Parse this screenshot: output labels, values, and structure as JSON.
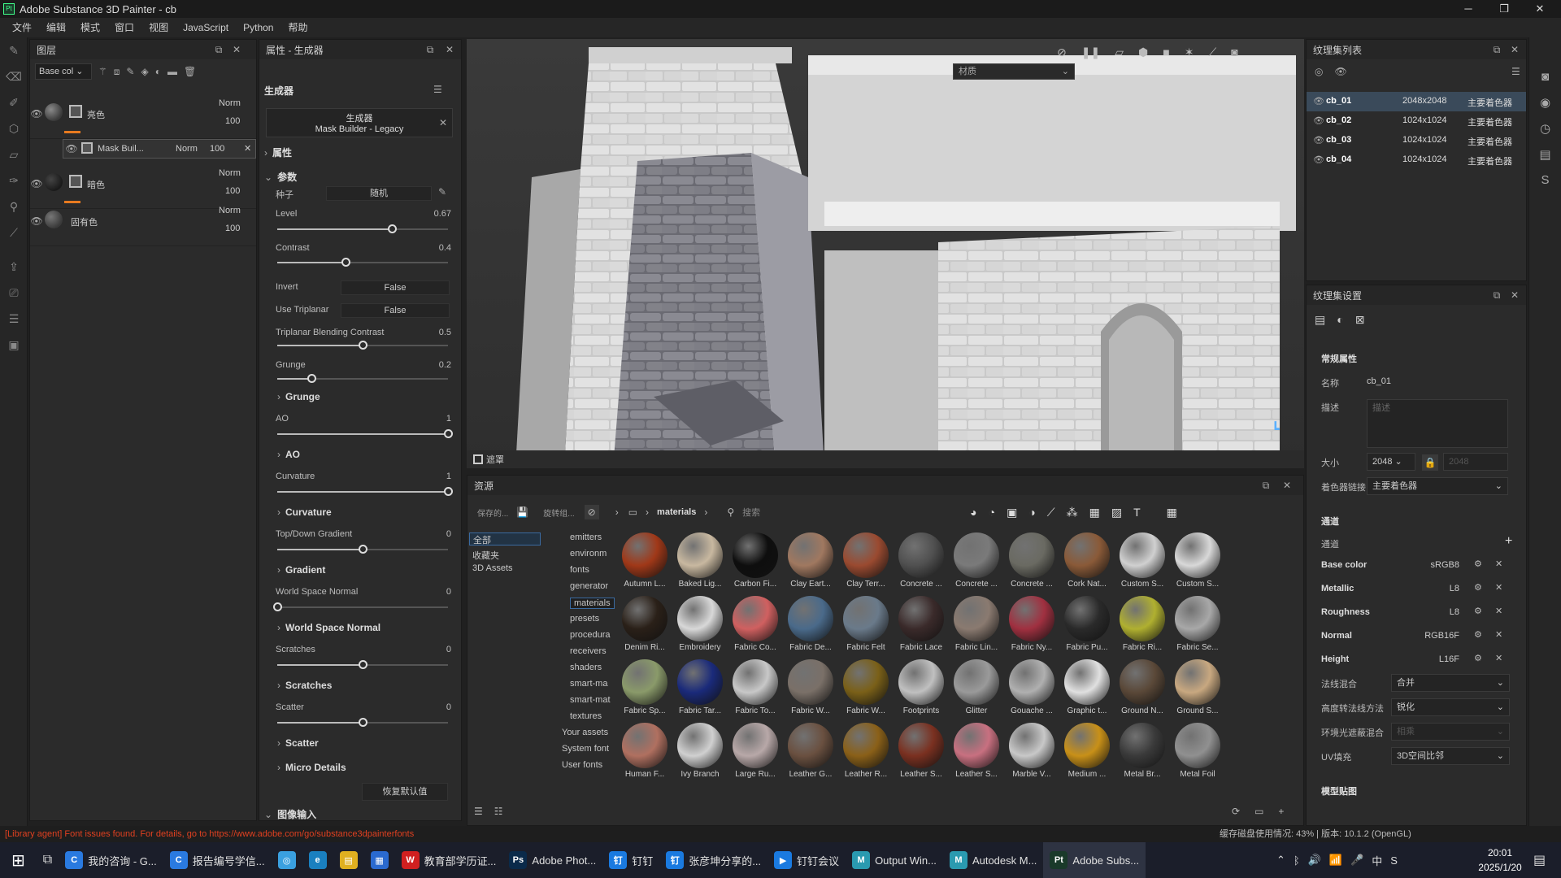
{
  "window": {
    "title": "Adobe Substance 3D Painter - cb",
    "logo": "Pt"
  },
  "menu": [
    "文件",
    "编辑",
    "模式",
    "窗口",
    "视图",
    "JavaScript",
    "Python",
    "帮助"
  ],
  "layers": {
    "title": "图层",
    "channel_select": "Base col",
    "items": [
      {
        "name": "亮色",
        "blend": "Norm",
        "opacity": "100"
      },
      {
        "name": "Mask Buil...",
        "blend": "Norm",
        "opacity": "100"
      },
      {
        "name": "暗色",
        "blend": "Norm",
        "opacity": "100"
      },
      {
        "name": "固有色",
        "blend": "Norm",
        "opacity": "100"
      }
    ]
  },
  "properties": {
    "title": "属性 - 生成器",
    "section": "生成器",
    "generator_title": "生成器",
    "generator_name": "Mask Builder - Legacy",
    "attr_label": "属性",
    "params_label": "参数",
    "seed_label": "种子",
    "seed_value": "随机",
    "params": [
      {
        "label": "Level",
        "value": "0.67",
        "pos": 0.67
      },
      {
        "label": "Contrast",
        "value": "0.4",
        "pos": 0.4
      },
      {
        "label": "Invert",
        "value": "False"
      },
      {
        "label": "Use Triplanar",
        "value": "False"
      },
      {
        "label": "Triplanar Blending Contrast",
        "value": "0.5",
        "pos": 0.5
      },
      {
        "label": "Grunge",
        "value": "0.2",
        "pos": 0.2
      },
      {
        "label": "AO",
        "value": "1",
        "pos": 1
      },
      {
        "label": "Curvature",
        "value": "1",
        "pos": 1
      },
      {
        "label": "Top/Down Gradient",
        "value": "0",
        "pos": 0.5
      },
      {
        "label": "World Space Normal",
        "value": "0",
        "pos": 0
      },
      {
        "label": "Scratches",
        "value": "0",
        "pos": 0.5
      },
      {
        "label": "Scatter",
        "value": "0",
        "pos": 0.5
      }
    ],
    "sections": [
      "Grunge",
      "AO",
      "Curvature",
      "Gradient",
      "World Space Normal",
      "Scratches",
      "Scatter",
      "Micro Details"
    ],
    "reset_button": "恢复默认值",
    "image_input": "图像输入"
  },
  "viewport": {
    "channel_select": "材质",
    "mask_label": "遮罩"
  },
  "assets": {
    "title": "资源",
    "saved_label": "保存的...",
    "filter_label": "旋转组...",
    "breadcrumb": "materials",
    "search_placeholder": "搜索",
    "left_tree": [
      "全部",
      "收藏夹",
      "3D Assets"
    ],
    "folders": [
      "emitters",
      "environm",
      "fonts",
      "generator",
      "materials",
      "presets",
      "procedura",
      "receivers",
      "shaders",
      "smart-ma",
      "smart-mat",
      "textures",
      "Your assets",
      "System font",
      "User fonts"
    ],
    "materials": [
      {
        "name": "Autumn L...",
        "color": "#a03818"
      },
      {
        "name": "Baked Lig...",
        "color": "#c8b8a0"
      },
      {
        "name": "Carbon Fi...",
        "color": "#0e0e0e"
      },
      {
        "name": "Clay Eart...",
        "color": "#a07860"
      },
      {
        "name": "Clay Terr...",
        "color": "#9a4a30"
      },
      {
        "name": "Concrete ...",
        "color": "#505050"
      },
      {
        "name": "Concrete ...",
        "color": "#7a7a7a"
      },
      {
        "name": "Concrete ...",
        "color": "#6a6a62"
      },
      {
        "name": "Cork Nat...",
        "color": "#8a5a38"
      },
      {
        "name": "Custom S...",
        "color": "#d0d0d0"
      },
      {
        "name": "Custom S...",
        "color": "#d8d8d8"
      },
      {
        "name": "Denim Ri...",
        "color": "#2a2018"
      },
      {
        "name": "Embroidery",
        "color": "#d8d8d8"
      },
      {
        "name": "Fabric Co...",
        "color": "#d06060"
      },
      {
        "name": "Fabric De...",
        "color": "#4a6a8a"
      },
      {
        "name": "Fabric Felt",
        "color": "#6a7a8a"
      },
      {
        "name": "Fabric Lace",
        "color": "#3a2a2a"
      },
      {
        "name": "Fabric Lin...",
        "color": "#8a7a70"
      },
      {
        "name": "Fabric Ny...",
        "color": "#a03040"
      },
      {
        "name": "Fabric Pu...",
        "color": "#2a2a2a"
      },
      {
        "name": "Fabric Ri...",
        "color": "#b0b030"
      },
      {
        "name": "Fabric Se...",
        "color": "#a8a8a8"
      },
      {
        "name": "Fabric Sp...",
        "color": "#8a9a6a"
      },
      {
        "name": "Fabric Tar...",
        "color": "#1a2a7a"
      },
      {
        "name": "Fabric To...",
        "color": "#c8c8c8"
      },
      {
        "name": "Fabric W...",
        "color": "#7a7068"
      },
      {
        "name": "Fabric W...",
        "color": "#7a6018"
      },
      {
        "name": "Footprints",
        "color": "#c0c0c0"
      },
      {
        "name": "Glitter",
        "color": "#9a9a9a"
      },
      {
        "name": "Gouache ...",
        "color": "#b0b0b0"
      },
      {
        "name": "Graphic t...",
        "color": "#e0e0e0"
      },
      {
        "name": "Ground N...",
        "color": "#5a4838"
      },
      {
        "name": "Ground S...",
        "color": "#c8a880"
      },
      {
        "name": "Human F...",
        "color": "#b07060"
      },
      {
        "name": "Ivy Branch",
        "color": "#d0d0d0"
      },
      {
        "name": "Large Ru...",
        "color": "#b8a8a8"
      },
      {
        "name": "Leather G...",
        "color": "#6a5040"
      },
      {
        "name": "Leather R...",
        "color": "#8a6018"
      },
      {
        "name": "Leather S...",
        "color": "#7a3020"
      },
      {
        "name": "Leather S...",
        "color": "#c87080"
      },
      {
        "name": "Marble V...",
        "color": "#c8c8c8"
      },
      {
        "name": "Medium ...",
        "color": "#c89018"
      },
      {
        "name": "Metal Br...",
        "color": "#3a3a3a"
      },
      {
        "name": "Metal Foil",
        "color": "#909090"
      }
    ]
  },
  "texture_sets": {
    "title": "纹理集列表",
    "rows": [
      {
        "name": "cb_01",
        "size": "2048x2048",
        "shader": "主要着色器"
      },
      {
        "name": "cb_02",
        "size": "1024x1024",
        "shader": "主要着色器"
      },
      {
        "name": "cb_03",
        "size": "1024x1024",
        "shader": "主要着色器"
      },
      {
        "name": "cb_04",
        "size": "1024x1024",
        "shader": "主要着色器"
      }
    ]
  },
  "ts_settings": {
    "title": "纹理集设置",
    "general": "常规属性",
    "name_label": "名称",
    "name_value": "cb_01",
    "desc_label": "描述",
    "desc_placeholder": "描述",
    "size_label": "大小",
    "size_value": "2048",
    "size_value2": "2048",
    "shader_link_label": "着色器链接",
    "shader_link_value": "主要着色器",
    "channels_title": "通道",
    "channels_label": "通道",
    "channels": [
      {
        "name": "Base color",
        "format": "sRGB8"
      },
      {
        "name": "Metallic",
        "format": "L8"
      },
      {
        "name": "Roughness",
        "format": "L8"
      },
      {
        "name": "Normal",
        "format": "RGB16F"
      },
      {
        "name": "Height",
        "format": "L16F"
      }
    ],
    "normal_mix_label": "法线混合",
    "normal_mix_value": "合并",
    "ao_label": "高度转法线方法",
    "ao_value": "锐化",
    "env_label": "环境光遮蔽混合",
    "env_value": "相乘",
    "uv_label": "UV填充",
    "uv_value": "3D空间比邻",
    "model_maps": "模型贴图"
  },
  "status": {
    "warning": "[Library agent] Font issues found. For details, go to https://www.adobe.com/go/substance3dpainterfonts",
    "right": "缓存磁盘使用情况:     43% | 版本: 10.1.2 (OpenGL)",
    "warn_color": "#e04020"
  },
  "taskbar": {
    "apps": [
      {
        "label": "我的咨询 - G...",
        "color": "#2a7ae0",
        "glyph": "C"
      },
      {
        "label": "报告编号学信...",
        "color": "#2a7ae0",
        "glyph": "C"
      },
      {
        "label": "",
        "color": "#3aa0e0",
        "glyph": "◎"
      },
      {
        "label": "",
        "color": "#1a80c0",
        "glyph": "e"
      },
      {
        "label": "",
        "color": "#e0b020",
        "glyph": "▤"
      },
      {
        "label": "",
        "color": "#2a6ad0",
        "glyph": "▦"
      },
      {
        "label": "教育部学历证...",
        "color": "#d02020",
        "glyph": "W"
      },
      {
        "label": "Adobe Phot...",
        "color": "#0a2a4a",
        "glyph": "Ps"
      },
      {
        "label": "钉钉",
        "color": "#1a7ae0",
        "glyph": "钉"
      },
      {
        "label": "张彦坤分享的...",
        "color": "#1a7ae0",
        "glyph": "钉"
      },
      {
        "label": "钉钉会议",
        "color": "#1a7ae0",
        "glyph": "▶"
      },
      {
        "label": "Output Win...",
        "color": "#2a9ab0",
        "glyph": "M"
      },
      {
        "label": "Autodesk M...",
        "color": "#2a9ab0",
        "glyph": "M"
      },
      {
        "label": "Adobe Subs...",
        "color": "#1a3a2a",
        "glyph": "Pt"
      }
    ],
    "time": "20:01",
    "date": "2025/1/20",
    "ime": "中"
  }
}
